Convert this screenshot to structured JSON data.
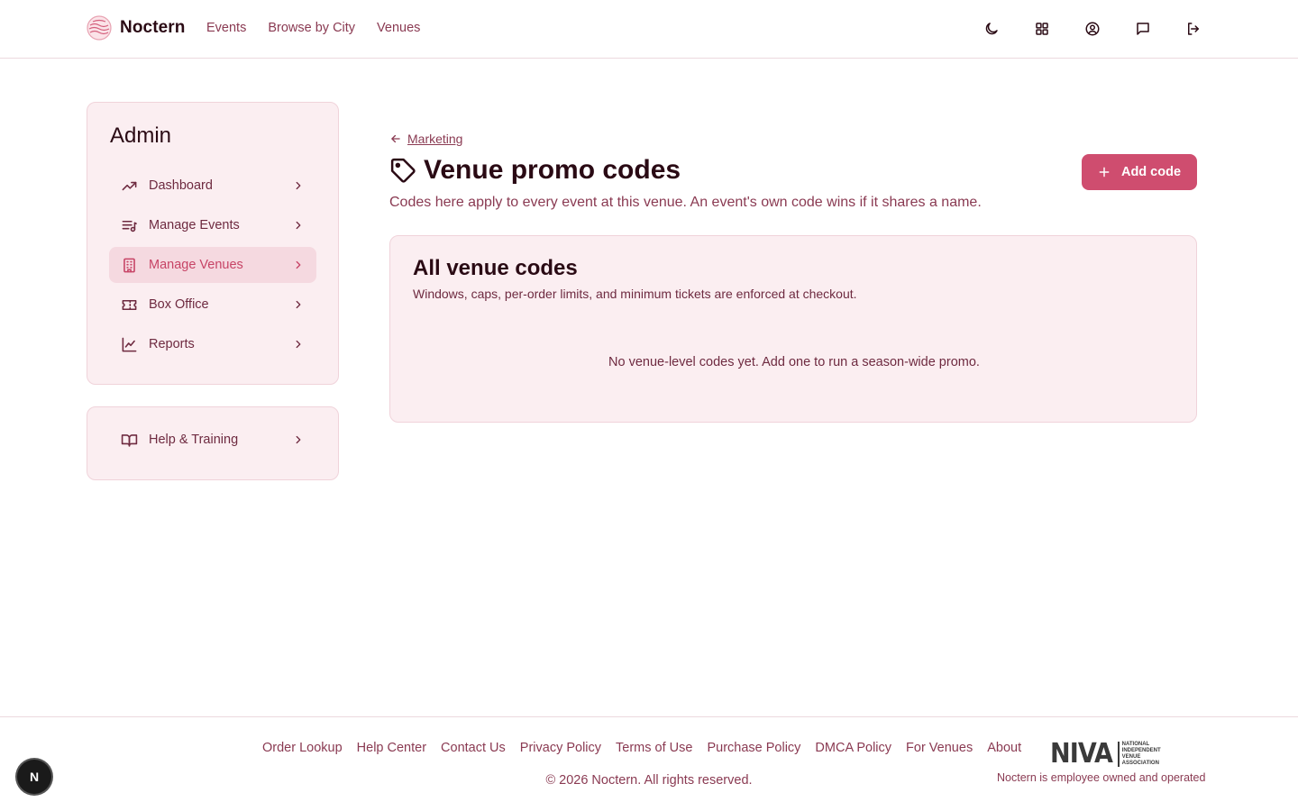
{
  "header": {
    "brand": "Noctern",
    "nav": [
      "Events",
      "Browse by City",
      "Venues"
    ],
    "icons": [
      "moon-icon",
      "grid-icon",
      "account-icon",
      "message-icon",
      "logout-icon"
    ]
  },
  "sidebar": {
    "title": "Admin",
    "items": [
      {
        "label": "Dashboard",
        "icon": "trending-up-icon",
        "active": false
      },
      {
        "label": "Manage Events",
        "icon": "list-music-icon",
        "active": false
      },
      {
        "label": "Manage Venues",
        "icon": "building-icon",
        "active": true
      },
      {
        "label": "Box Office",
        "icon": "ticket-icon",
        "active": false
      },
      {
        "label": "Reports",
        "icon": "line-chart-icon",
        "active": false
      }
    ],
    "help": {
      "label": "Help & Training",
      "icon": "book-icon"
    }
  },
  "main": {
    "back_label": "Marketing",
    "title": "Venue promo codes",
    "subtitle": "Codes here apply to every event at this venue. An event's own code wins if it shares a name.",
    "add_button": "Add code",
    "card": {
      "title": "All venue codes",
      "description": "Windows, caps, per-order limits, and minimum tickets are enforced at checkout.",
      "empty": "No venue-level codes yet. Add one to run a season-wide promo."
    }
  },
  "footer": {
    "links": [
      "Order Lookup",
      "Help Center",
      "Contact Us",
      "Privacy Policy",
      "Terms of Use",
      "Purchase Policy",
      "DMCA Policy",
      "For Venues",
      "About"
    ],
    "copyright": "© 2026 Noctern. All rights reserved.",
    "niva_logo": "NIVA",
    "niva_logo_sub": "National Independent Venue Association",
    "niva_caption": "Noctern is employee owned and operated"
  },
  "fab_label": "N",
  "colors": {
    "accent": "#cf4d6f",
    "panel": "#fbeef1",
    "text": "#2a0a14",
    "muted": "#8a3a52"
  }
}
